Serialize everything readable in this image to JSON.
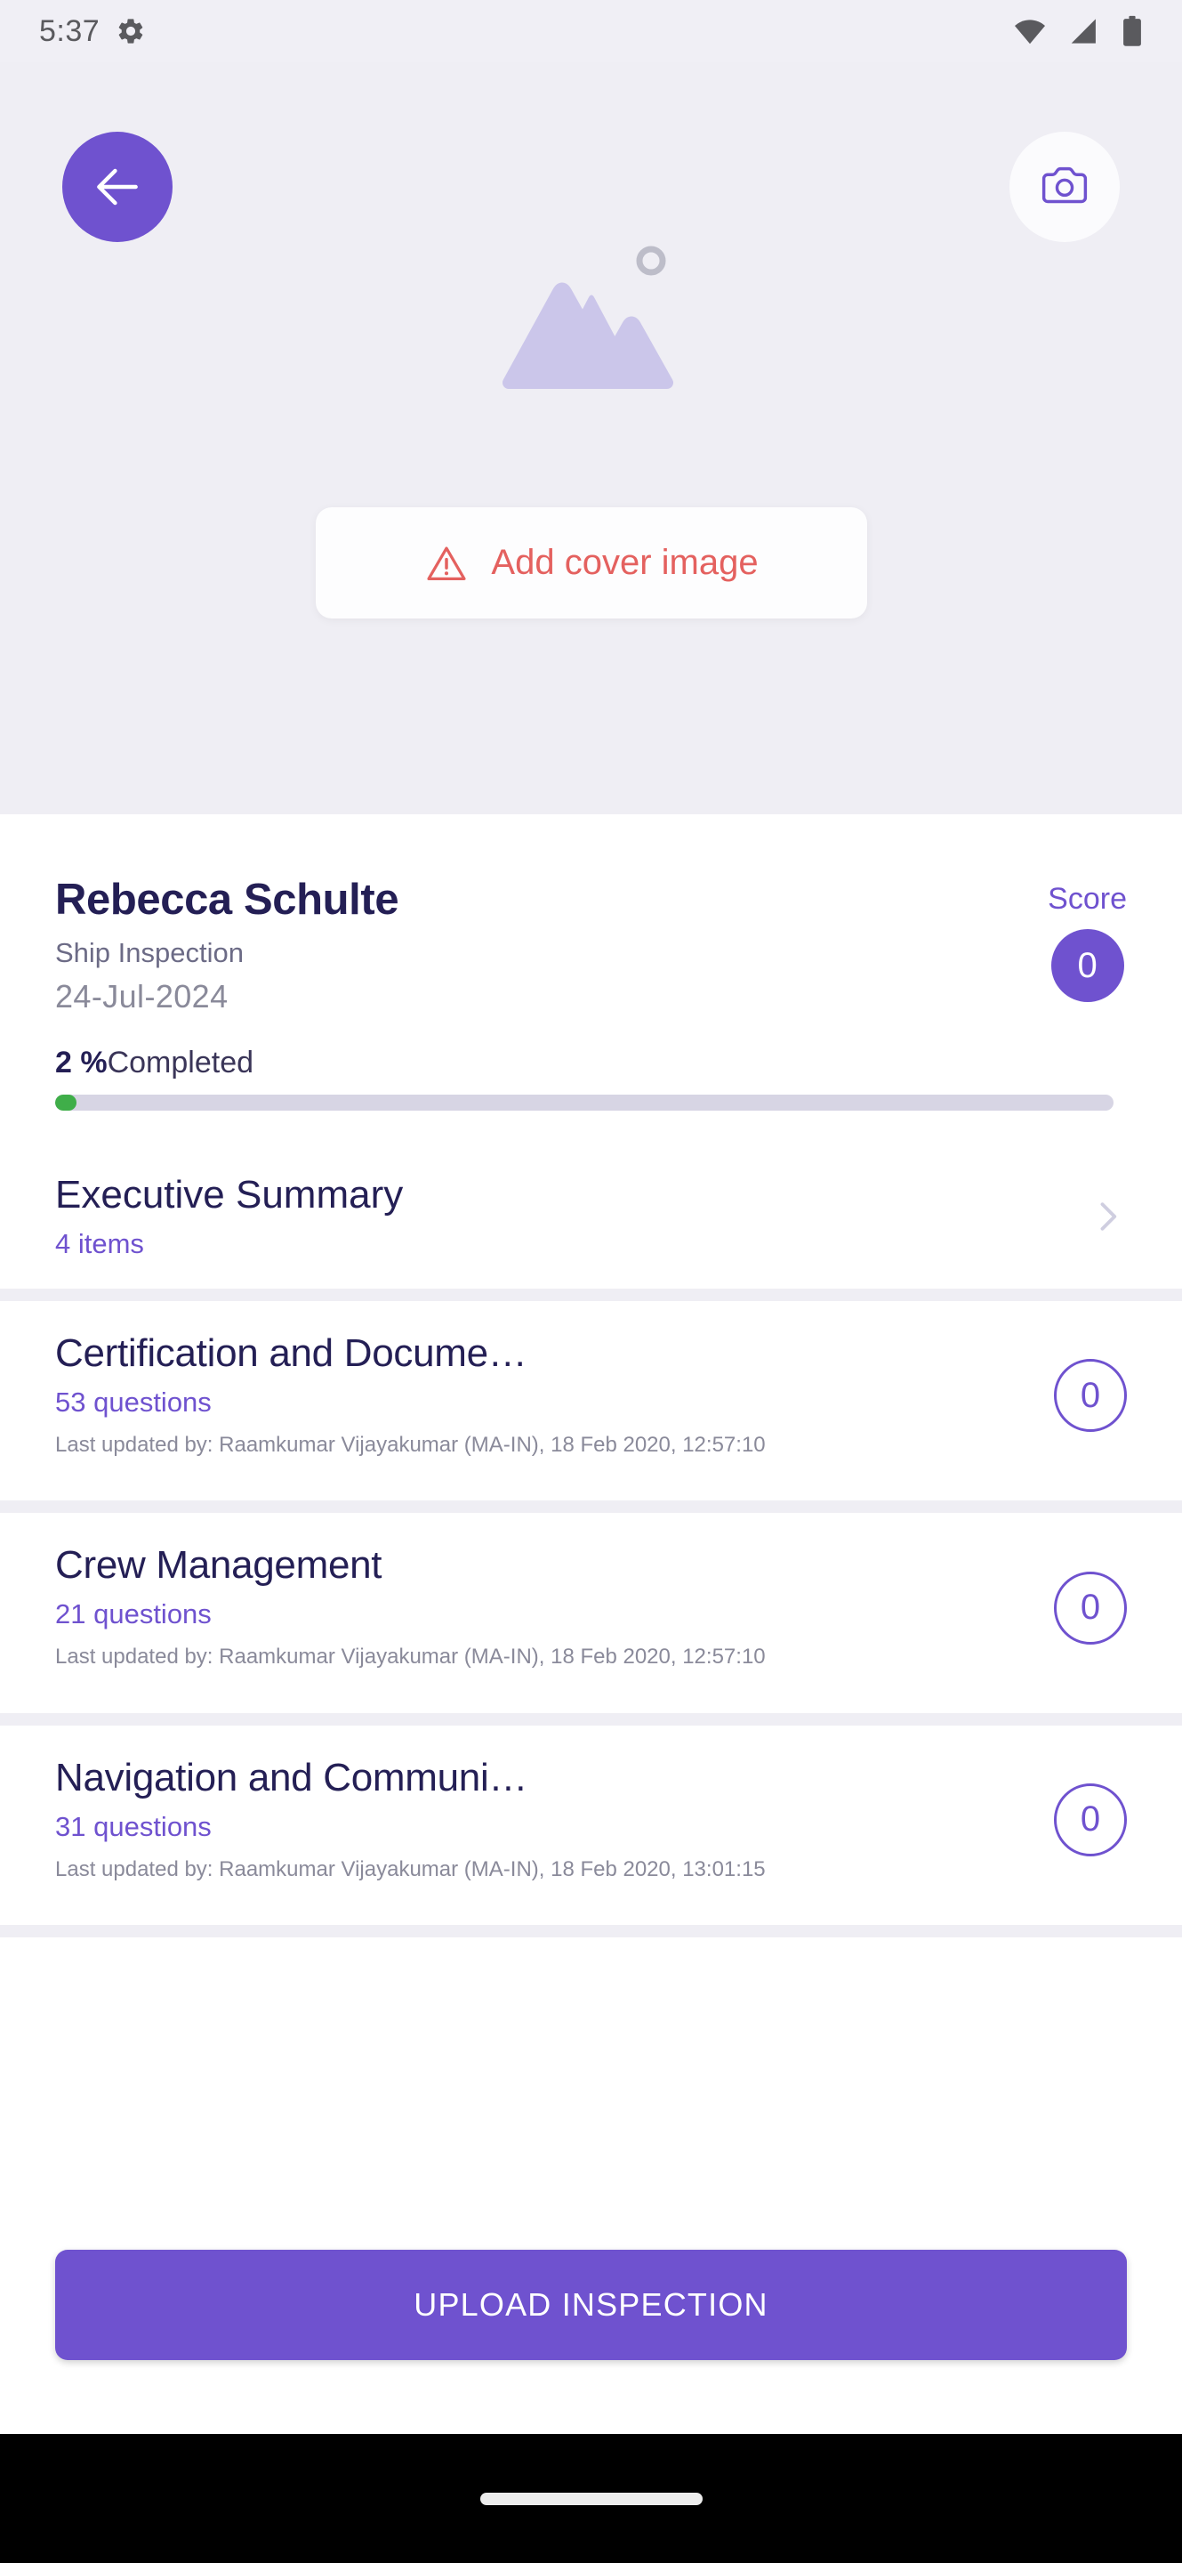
{
  "status_bar": {
    "time": "5:37",
    "icons": [
      "gear-icon",
      "wifi-icon",
      "cellular-signal-icon",
      "battery-icon"
    ]
  },
  "hero": {
    "back_icon": "arrow-left-icon",
    "camera_icon": "camera-icon",
    "placeholder_icon": "image-placeholder-icon",
    "add_cover_label": "Add cover image",
    "add_cover_icon": "warning-triangle-icon",
    "accent_color": "#6f52cf",
    "warning_color": "#e4615f",
    "background_color": "#efeef4"
  },
  "inspection": {
    "name": "Rebecca Schulte",
    "type": "Ship Inspection",
    "date": "24-Jul-2024",
    "score_label": "Score",
    "score_value": "0",
    "progress_percent": "2 %",
    "progress_suffix": "Completed",
    "progress_fill_pct": 2,
    "progress_color": "#3fae49"
  },
  "executive_summary": {
    "title": "Executive Summary",
    "subtitle": "4 items",
    "chevron_icon": "chevron-right-icon"
  },
  "sections": [
    {
      "title": "Certification and Docume…",
      "questions": "53 questions",
      "meta": "Last updated by: Raamkumar Vijayakumar (MA-IN), 18 Feb 2020, 12:57:10",
      "score": "0"
    },
    {
      "title": "Crew Management",
      "questions": "21 questions",
      "meta": "Last updated by: Raamkumar Vijayakumar (MA-IN), 18 Feb 2020, 12:57:10",
      "score": "0"
    },
    {
      "title": "Navigation and Communi…",
      "questions": "31 questions",
      "meta": "Last updated by: Raamkumar Vijayakumar (MA-IN), 18 Feb 2020, 13:01:15",
      "score": "0"
    }
  ],
  "footer": {
    "upload_label": "UPLOAD INSPECTION"
  }
}
